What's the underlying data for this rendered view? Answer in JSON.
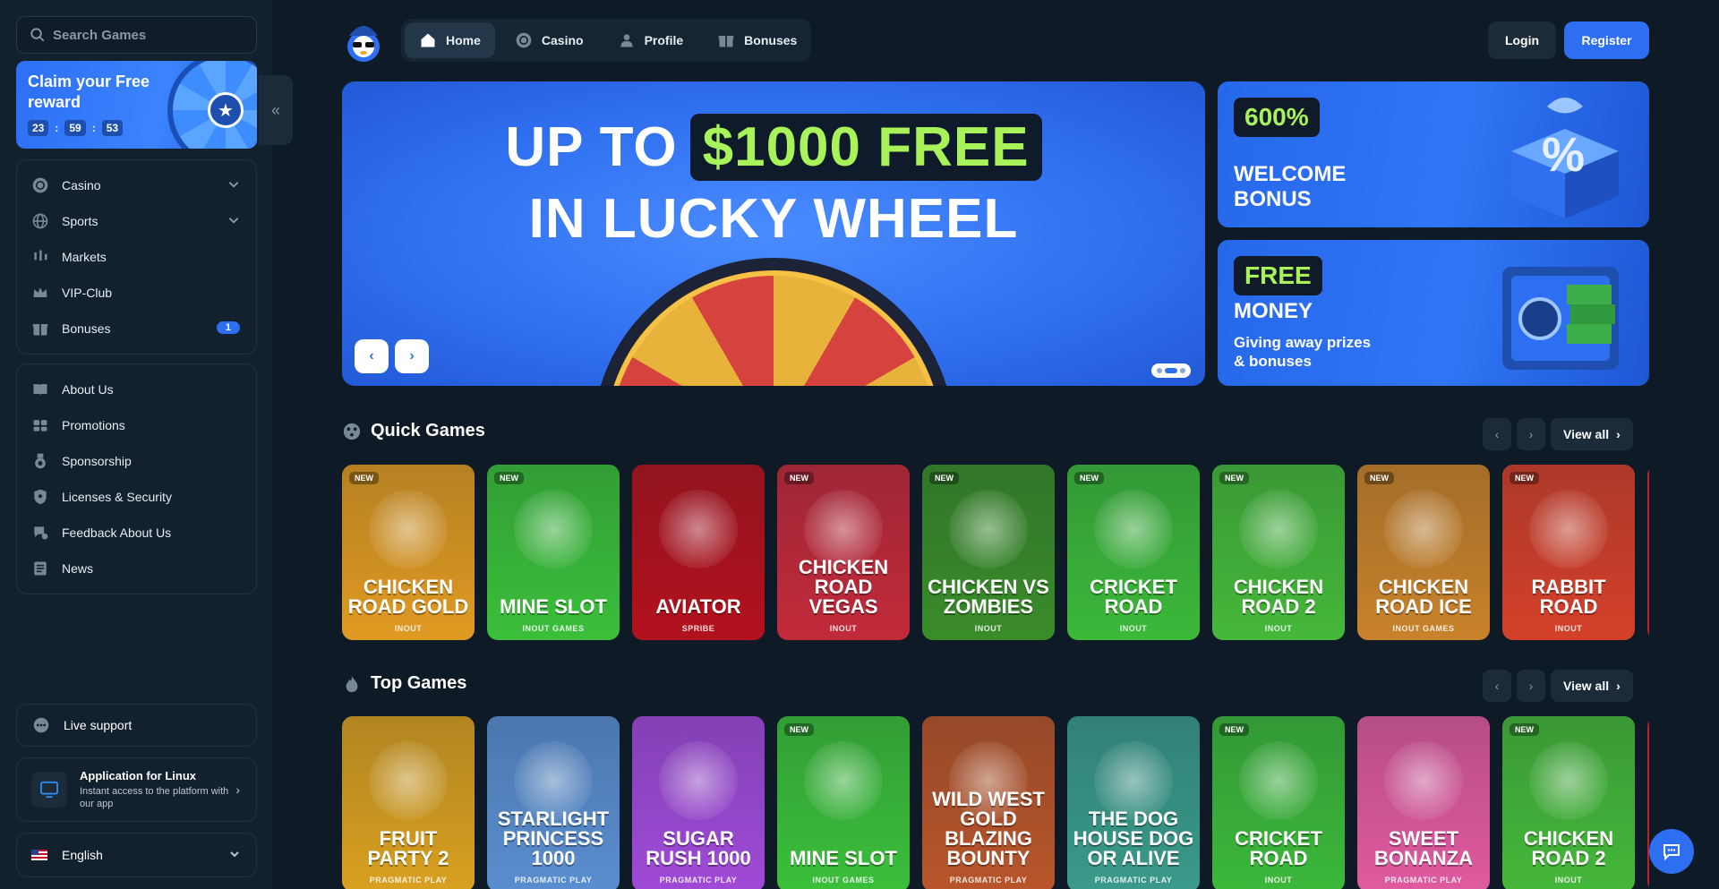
{
  "search": {
    "placeholder": "Search Games"
  },
  "reward": {
    "title": "Claim your Free reward",
    "timer": [
      "23",
      "59",
      "53"
    ]
  },
  "nav_main": [
    {
      "label": "Casino",
      "icon": "casino-chip-icon",
      "chevron": true
    },
    {
      "label": "Sports",
      "icon": "globe-icon",
      "chevron": true
    },
    {
      "label": "Markets",
      "icon": "candlestick-icon"
    },
    {
      "label": "VIP-Club",
      "icon": "crown-icon"
    },
    {
      "label": "Bonuses",
      "icon": "gift-icon",
      "badge": "1"
    }
  ],
  "nav_info": [
    {
      "label": "About Us",
      "icon": "book-icon"
    },
    {
      "label": "Promotions",
      "icon": "megaphone-icon"
    },
    {
      "label": "Sponsorship",
      "icon": "medal-icon"
    },
    {
      "label": "Licenses & Security",
      "icon": "shield-icon"
    },
    {
      "label": "Feedback About Us",
      "icon": "chat-bubble-icon"
    },
    {
      "label": "News",
      "icon": "newspaper-icon"
    }
  ],
  "live_support": "Live support",
  "app": {
    "title": "Application for Linux",
    "subtitle": "Instant access to the platform with our app"
  },
  "language": "English",
  "topnav": [
    {
      "label": "Home",
      "icon": "home-icon",
      "active": true
    },
    {
      "label": "Casino",
      "icon": "casino-chip-icon"
    },
    {
      "label": "Profile",
      "icon": "user-icon"
    },
    {
      "label": "Bonuses",
      "icon": "gift-icon"
    }
  ],
  "auth": {
    "login": "Login",
    "register": "Register"
  },
  "hero": {
    "line1_a": "UP TO",
    "line1_b": "$1000 FREE",
    "line2": "IN LUCKY WHEEL"
  },
  "promo1": {
    "tag": "600%",
    "title": "WELCOME BONUS"
  },
  "promo2": {
    "tag": "FREE",
    "title": "MONEY",
    "subtitle": "Giving away prizes & bonuses"
  },
  "sections": {
    "quick": {
      "title": "Quick Games",
      "view_all": "View all"
    },
    "top": {
      "title": "Top Games",
      "view_all": "View all"
    }
  },
  "quick_games": [
    {
      "name": "Chicken Road Gold",
      "provider": "INOUT",
      "new": true,
      "color": "#e09a22"
    },
    {
      "name": "Mine Slot",
      "provider": "INOUT GAMES",
      "new": true,
      "color": "#3bbf3a"
    },
    {
      "name": "Aviator",
      "provider": "SPRIBE",
      "new": false,
      "color": "#b3121e"
    },
    {
      "name": "Chicken Road Vegas",
      "provider": "INOUT",
      "new": true,
      "color": "#c22a3a"
    },
    {
      "name": "Chicken vs Zombies",
      "provider": "INOUT",
      "new": true,
      "color": "#3a8c2a"
    },
    {
      "name": "Cricket Road",
      "provider": "INOUT",
      "new": true,
      "color": "#3cb83a"
    },
    {
      "name": "Chicken Road 2",
      "provider": "INOUT",
      "new": true,
      "color": "#45b83a"
    },
    {
      "name": "Chicken Road Ice",
      "provider": "INOUT GAMES",
      "new": true,
      "color": "#c9822a"
    },
    {
      "name": "Rabbit Road",
      "provider": "INOUT",
      "new": true,
      "color": "#d4402a"
    }
  ],
  "top_games": [
    {
      "name": "Fruit Party 2",
      "provider": "PRAGMATIC PLAY",
      "new": false,
      "color": "#d9a020"
    },
    {
      "name": "Starlight Princess 1000",
      "provider": "PRAGMATIC PLAY",
      "new": false,
      "color": "#5a8ed0"
    },
    {
      "name": "Sugar Rush 1000",
      "provider": "PRAGMATIC PLAY",
      "new": false,
      "color": "#a04ad8"
    },
    {
      "name": "Mine Slot",
      "provider": "INOUT GAMES",
      "new": true,
      "color": "#3bbf3a"
    },
    {
      "name": "Wild West Gold Blazing Bounty",
      "provider": "PRAGMATIC PLAY",
      "new": false,
      "color": "#b8552a"
    },
    {
      "name": "The Dog House Dog or Alive",
      "provider": "PRAGMATIC PLAY",
      "new": false,
      "color": "#3a9a8a"
    },
    {
      "name": "Cricket Road",
      "provider": "INOUT",
      "new": true,
      "color": "#3cb83a"
    },
    {
      "name": "Sweet Bonanza",
      "provider": "PRAGMATIC PLAY",
      "new": false,
      "color": "#e05aa0"
    },
    {
      "name": "Chicken Road 2",
      "provider": "INOUT",
      "new": true,
      "color": "#45b83a"
    }
  ],
  "new_label": "NEW"
}
